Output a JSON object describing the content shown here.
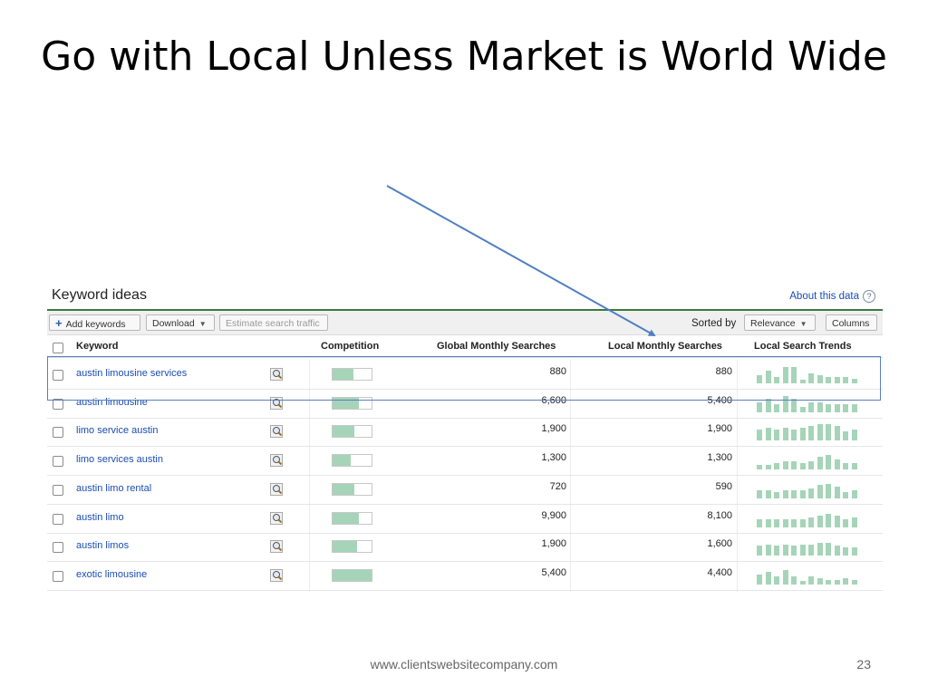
{
  "slide": {
    "title": "Go with Local Unless Market is World Wide",
    "footer_url": "www.clientswebsitecompany.com",
    "page_number": "23"
  },
  "panel": {
    "title": "Keyword ideas",
    "about_link": "About this data",
    "help_icon": "?",
    "toolbar": {
      "add_keywords": "Add keywords",
      "download": "Download",
      "estimate": "Estimate search traffic",
      "sorted_by": "Sorted by",
      "relevance": "Relevance",
      "columns": "Columns"
    },
    "columns": {
      "keyword": "Keyword",
      "competition": "Competition",
      "global": "Global Monthly Searches",
      "local": "Local Monthly Searches",
      "trends": "Local Search Trends"
    },
    "accent_color": "#3b7a3b",
    "bar_color": "#a6d4b8",
    "link_color": "#1a4db3"
  },
  "rows": [
    {
      "keyword": "austin limousine services",
      "competition": 0.53,
      "global": "880",
      "local": "880",
      "trend": [
        5,
        8,
        4,
        10,
        10,
        2,
        6,
        5,
        4,
        4,
        4,
        3
      ]
    },
    {
      "keyword": "austin limousine",
      "competition": 0.67,
      "global": "6,600",
      "local": "5,400",
      "trend": [
        6,
        8,
        5,
        10,
        8,
        3,
        6,
        6,
        5,
        5,
        5,
        5
      ]
    },
    {
      "keyword": "limo service austin",
      "competition": 0.55,
      "global": "1,900",
      "local": "1,900",
      "trend": [
        7,
        8,
        7,
        8,
        7,
        8,
        9,
        10,
        10,
        9,
        6,
        7
      ]
    },
    {
      "keyword": "limo services austin",
      "competition": 0.47,
      "global": "1,300",
      "local": "1,300",
      "trend": [
        3,
        3,
        4,
        5,
        5,
        4,
        5,
        8,
        9,
        6,
        4,
        4
      ]
    },
    {
      "keyword": "austin limo rental",
      "competition": 0.55,
      "global": "720",
      "local": "590",
      "trend": [
        5,
        5,
        4,
        5,
        5,
        5,
        6,
        8,
        9,
        7,
        4,
        5
      ]
    },
    {
      "keyword": "austin limo",
      "competition": 0.67,
      "global": "9,900",
      "local": "8,100",
      "trend": [
        5,
        5,
        5,
        5,
        5,
        5,
        6,
        7,
        8,
        7,
        5,
        6
      ]
    },
    {
      "keyword": "austin limos",
      "competition": 0.63,
      "global": "1,900",
      "local": "1,600",
      "trend": [
        6,
        7,
        6,
        7,
        6,
        7,
        7,
        8,
        8,
        6,
        5,
        5
      ]
    },
    {
      "keyword": "exotic limousine",
      "competition": 1.0,
      "global": "5,400",
      "local": "4,400",
      "trend": [
        6,
        8,
        5,
        9,
        5,
        2,
        5,
        4,
        3,
        3,
        4,
        3
      ]
    }
  ]
}
